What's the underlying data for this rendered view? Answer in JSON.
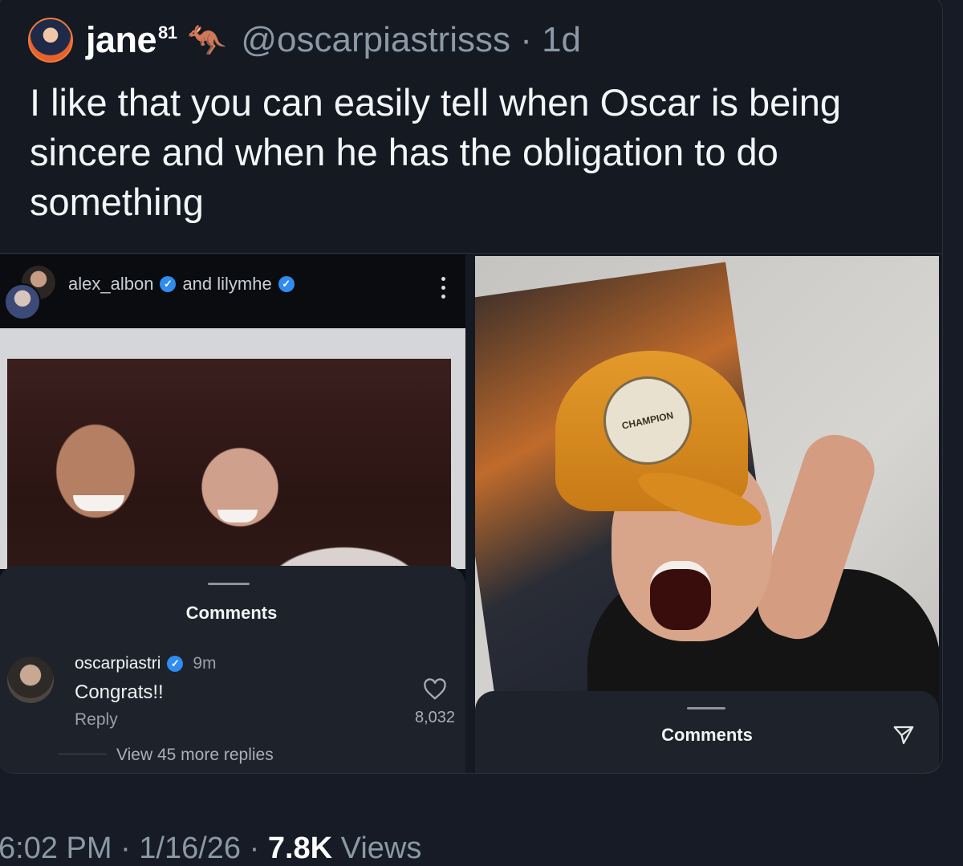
{
  "tweet": {
    "display_name": "jane",
    "display_name_sup": "81",
    "emoji": "🦘",
    "handle_time": "@oscarpiastrisss · 1d",
    "text": "I like that you can easily tell when Oscar is being sincere and when he has the obligation to do something"
  },
  "left_post": {
    "user1": "alex_albon",
    "and_text": "and lilymhe",
    "comments_title": "Comments",
    "comment": {
      "username": "oscarpiastri",
      "time": "9m",
      "text": "Congrats!!",
      "reply": "Reply",
      "likes": "8,032"
    },
    "view_more": "View 45 more replies"
  },
  "right_post": {
    "cap_text": "CHAMPION",
    "comments_title": "Comments"
  },
  "footer": {
    "time_date": "6:02 PM · 1/16/26 · ",
    "views_count": "7.8K",
    "views_label": " Views"
  },
  "colors": {
    "background": "#141922",
    "verified": "#2f8cf0",
    "muted": "#8b98a5"
  }
}
